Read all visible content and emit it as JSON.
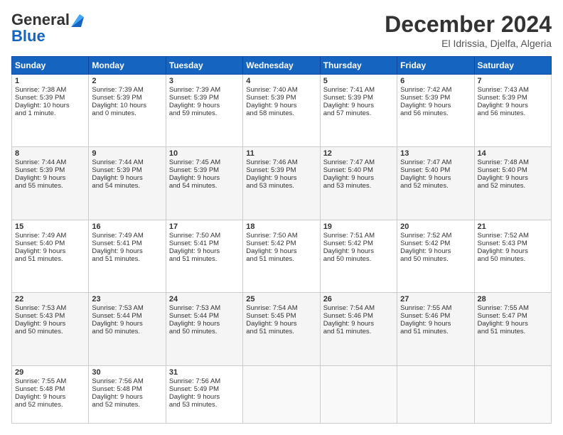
{
  "logo": {
    "general": "General",
    "blue": "Blue"
  },
  "header": {
    "month": "December 2024",
    "location": "El Idrissia, Djelfa, Algeria"
  },
  "weekdays": [
    "Sunday",
    "Monday",
    "Tuesday",
    "Wednesday",
    "Thursday",
    "Friday",
    "Saturday"
  ],
  "weeks": [
    [
      {
        "day": "1",
        "lines": [
          "Sunrise: 7:38 AM",
          "Sunset: 5:39 PM",
          "Daylight: 10 hours",
          "and 1 minute."
        ]
      },
      {
        "day": "2",
        "lines": [
          "Sunrise: 7:39 AM",
          "Sunset: 5:39 PM",
          "Daylight: 10 hours",
          "and 0 minutes."
        ]
      },
      {
        "day": "3",
        "lines": [
          "Sunrise: 7:39 AM",
          "Sunset: 5:39 PM",
          "Daylight: 9 hours",
          "and 59 minutes."
        ]
      },
      {
        "day": "4",
        "lines": [
          "Sunrise: 7:40 AM",
          "Sunset: 5:39 PM",
          "Daylight: 9 hours",
          "and 58 minutes."
        ]
      },
      {
        "day": "5",
        "lines": [
          "Sunrise: 7:41 AM",
          "Sunset: 5:39 PM",
          "Daylight: 9 hours",
          "and 57 minutes."
        ]
      },
      {
        "day": "6",
        "lines": [
          "Sunrise: 7:42 AM",
          "Sunset: 5:39 PM",
          "Daylight: 9 hours",
          "and 56 minutes."
        ]
      },
      {
        "day": "7",
        "lines": [
          "Sunrise: 7:43 AM",
          "Sunset: 5:39 PM",
          "Daylight: 9 hours",
          "and 56 minutes."
        ]
      }
    ],
    [
      {
        "day": "8",
        "lines": [
          "Sunrise: 7:44 AM",
          "Sunset: 5:39 PM",
          "Daylight: 9 hours",
          "and 55 minutes."
        ]
      },
      {
        "day": "9",
        "lines": [
          "Sunrise: 7:44 AM",
          "Sunset: 5:39 PM",
          "Daylight: 9 hours",
          "and 54 minutes."
        ]
      },
      {
        "day": "10",
        "lines": [
          "Sunrise: 7:45 AM",
          "Sunset: 5:39 PM",
          "Daylight: 9 hours",
          "and 54 minutes."
        ]
      },
      {
        "day": "11",
        "lines": [
          "Sunrise: 7:46 AM",
          "Sunset: 5:39 PM",
          "Daylight: 9 hours",
          "and 53 minutes."
        ]
      },
      {
        "day": "12",
        "lines": [
          "Sunrise: 7:47 AM",
          "Sunset: 5:40 PM",
          "Daylight: 9 hours",
          "and 53 minutes."
        ]
      },
      {
        "day": "13",
        "lines": [
          "Sunrise: 7:47 AM",
          "Sunset: 5:40 PM",
          "Daylight: 9 hours",
          "and 52 minutes."
        ]
      },
      {
        "day": "14",
        "lines": [
          "Sunrise: 7:48 AM",
          "Sunset: 5:40 PM",
          "Daylight: 9 hours",
          "and 52 minutes."
        ]
      }
    ],
    [
      {
        "day": "15",
        "lines": [
          "Sunrise: 7:49 AM",
          "Sunset: 5:40 PM",
          "Daylight: 9 hours",
          "and 51 minutes."
        ]
      },
      {
        "day": "16",
        "lines": [
          "Sunrise: 7:49 AM",
          "Sunset: 5:41 PM",
          "Daylight: 9 hours",
          "and 51 minutes."
        ]
      },
      {
        "day": "17",
        "lines": [
          "Sunrise: 7:50 AM",
          "Sunset: 5:41 PM",
          "Daylight: 9 hours",
          "and 51 minutes."
        ]
      },
      {
        "day": "18",
        "lines": [
          "Sunrise: 7:50 AM",
          "Sunset: 5:42 PM",
          "Daylight: 9 hours",
          "and 51 minutes."
        ]
      },
      {
        "day": "19",
        "lines": [
          "Sunrise: 7:51 AM",
          "Sunset: 5:42 PM",
          "Daylight: 9 hours",
          "and 50 minutes."
        ]
      },
      {
        "day": "20",
        "lines": [
          "Sunrise: 7:52 AM",
          "Sunset: 5:42 PM",
          "Daylight: 9 hours",
          "and 50 minutes."
        ]
      },
      {
        "day": "21",
        "lines": [
          "Sunrise: 7:52 AM",
          "Sunset: 5:43 PM",
          "Daylight: 9 hours",
          "and 50 minutes."
        ]
      }
    ],
    [
      {
        "day": "22",
        "lines": [
          "Sunrise: 7:53 AM",
          "Sunset: 5:43 PM",
          "Daylight: 9 hours",
          "and 50 minutes."
        ]
      },
      {
        "day": "23",
        "lines": [
          "Sunrise: 7:53 AM",
          "Sunset: 5:44 PM",
          "Daylight: 9 hours",
          "and 50 minutes."
        ]
      },
      {
        "day": "24",
        "lines": [
          "Sunrise: 7:53 AM",
          "Sunset: 5:44 PM",
          "Daylight: 9 hours",
          "and 50 minutes."
        ]
      },
      {
        "day": "25",
        "lines": [
          "Sunrise: 7:54 AM",
          "Sunset: 5:45 PM",
          "Daylight: 9 hours",
          "and 51 minutes."
        ]
      },
      {
        "day": "26",
        "lines": [
          "Sunrise: 7:54 AM",
          "Sunset: 5:46 PM",
          "Daylight: 9 hours",
          "and 51 minutes."
        ]
      },
      {
        "day": "27",
        "lines": [
          "Sunrise: 7:55 AM",
          "Sunset: 5:46 PM",
          "Daylight: 9 hours",
          "and 51 minutes."
        ]
      },
      {
        "day": "28",
        "lines": [
          "Sunrise: 7:55 AM",
          "Sunset: 5:47 PM",
          "Daylight: 9 hours",
          "and 51 minutes."
        ]
      }
    ],
    [
      {
        "day": "29",
        "lines": [
          "Sunrise: 7:55 AM",
          "Sunset: 5:48 PM",
          "Daylight: 9 hours",
          "and 52 minutes."
        ]
      },
      {
        "day": "30",
        "lines": [
          "Sunrise: 7:56 AM",
          "Sunset: 5:48 PM",
          "Daylight: 9 hours",
          "and 52 minutes."
        ]
      },
      {
        "day": "31",
        "lines": [
          "Sunrise: 7:56 AM",
          "Sunset: 5:49 PM",
          "Daylight: 9 hours",
          "and 53 minutes."
        ]
      },
      null,
      null,
      null,
      null
    ]
  ]
}
